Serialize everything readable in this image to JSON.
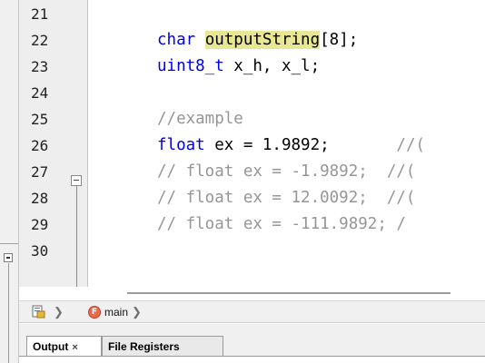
{
  "editor": {
    "line_numbers": [
      "21",
      "22",
      "23",
      "24",
      "25",
      "26",
      "27",
      "28",
      "29",
      "30"
    ],
    "lines": [
      {
        "segments": []
      },
      {
        "segments": [
          {
            "text": "char ",
            "style": "kw"
          },
          {
            "text": "outputString",
            "style": "hl"
          },
          {
            "text": "[8];",
            "style": "plain"
          }
        ]
      },
      {
        "segments": [
          {
            "text": "uint8_t ",
            "style": "kw"
          },
          {
            "text": "x_h, x_l;",
            "style": "plain"
          }
        ]
      },
      {
        "segments": []
      },
      {
        "segments": [
          {
            "text": "//example",
            "style": "cmt"
          }
        ]
      },
      {
        "segments": [
          {
            "text": "float ",
            "style": "kw"
          },
          {
            "text": "ex = 1.9892;",
            "style": "plain"
          },
          {
            "text": "       //(",
            "style": "cmt"
          }
        ]
      },
      {
        "segments": [
          {
            "text": "// float ex = -1.9892;  //(",
            "style": "cmt"
          }
        ]
      },
      {
        "segments": [
          {
            "text": "// float ex = 12.0092;  //(",
            "style": "cmt"
          }
        ]
      },
      {
        "segments": [
          {
            "text": "// float ex = -111.9892; /",
            "style": "cmt"
          }
        ]
      },
      {
        "segments": []
      }
    ]
  },
  "breadcrumb": {
    "file_icon": "file-icon",
    "separator": "❯",
    "function_icon": "function-icon",
    "function_icon_glyph": "F",
    "function_name": "main"
  },
  "bottom_tabs": {
    "output_label": "Output",
    "output_close": "×",
    "file_registers_label": "File Registers"
  },
  "colors": {
    "keyword": "#0000e6",
    "comment": "#969696",
    "highlight": "#e8e894",
    "gutter": "#eeeeee"
  }
}
